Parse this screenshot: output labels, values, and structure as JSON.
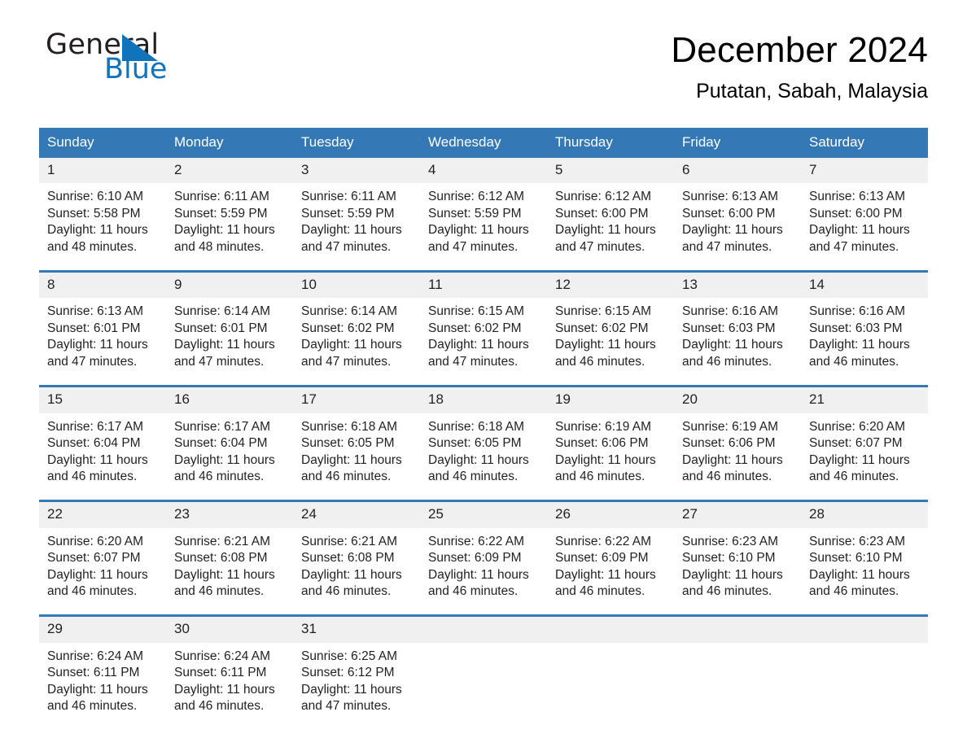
{
  "brand": {
    "name_part1": "General",
    "name_part2": "Blue",
    "logo_icon": "triangle-logo-icon",
    "accent_color": "#1173ba"
  },
  "header": {
    "title": "December 2024",
    "subtitle": "Putatan, Sabah, Malaysia"
  },
  "calendar": {
    "header_bg": "#3478b6",
    "daynum_bg": "#f0f0f0",
    "weekday_headers": [
      "Sunday",
      "Monday",
      "Tuesday",
      "Wednesday",
      "Thursday",
      "Friday",
      "Saturday"
    ],
    "weeks": [
      {
        "days": [
          {
            "num": "1",
            "sunrise": "Sunrise: 6:10 AM",
            "sunset": "Sunset: 5:58 PM",
            "daylight_line1": "Daylight: 11 hours",
            "daylight_line2": "and 48 minutes."
          },
          {
            "num": "2",
            "sunrise": "Sunrise: 6:11 AM",
            "sunset": "Sunset: 5:59 PM",
            "daylight_line1": "Daylight: 11 hours",
            "daylight_line2": "and 48 minutes."
          },
          {
            "num": "3",
            "sunrise": "Sunrise: 6:11 AM",
            "sunset": "Sunset: 5:59 PM",
            "daylight_line1": "Daylight: 11 hours",
            "daylight_line2": "and 47 minutes."
          },
          {
            "num": "4",
            "sunrise": "Sunrise: 6:12 AM",
            "sunset": "Sunset: 5:59 PM",
            "daylight_line1": "Daylight: 11 hours",
            "daylight_line2": "and 47 minutes."
          },
          {
            "num": "5",
            "sunrise": "Sunrise: 6:12 AM",
            "sunset": "Sunset: 6:00 PM",
            "daylight_line1": "Daylight: 11 hours",
            "daylight_line2": "and 47 minutes."
          },
          {
            "num": "6",
            "sunrise": "Sunrise: 6:13 AM",
            "sunset": "Sunset: 6:00 PM",
            "daylight_line1": "Daylight: 11 hours",
            "daylight_line2": "and 47 minutes."
          },
          {
            "num": "7",
            "sunrise": "Sunrise: 6:13 AM",
            "sunset": "Sunset: 6:00 PM",
            "daylight_line1": "Daylight: 11 hours",
            "daylight_line2": "and 47 minutes."
          }
        ]
      },
      {
        "days": [
          {
            "num": "8",
            "sunrise": "Sunrise: 6:13 AM",
            "sunset": "Sunset: 6:01 PM",
            "daylight_line1": "Daylight: 11 hours",
            "daylight_line2": "and 47 minutes."
          },
          {
            "num": "9",
            "sunrise": "Sunrise: 6:14 AM",
            "sunset": "Sunset: 6:01 PM",
            "daylight_line1": "Daylight: 11 hours",
            "daylight_line2": "and 47 minutes."
          },
          {
            "num": "10",
            "sunrise": "Sunrise: 6:14 AM",
            "sunset": "Sunset: 6:02 PM",
            "daylight_line1": "Daylight: 11 hours",
            "daylight_line2": "and 47 minutes."
          },
          {
            "num": "11",
            "sunrise": "Sunrise: 6:15 AM",
            "sunset": "Sunset: 6:02 PM",
            "daylight_line1": "Daylight: 11 hours",
            "daylight_line2": "and 47 minutes."
          },
          {
            "num": "12",
            "sunrise": "Sunrise: 6:15 AM",
            "sunset": "Sunset: 6:02 PM",
            "daylight_line1": "Daylight: 11 hours",
            "daylight_line2": "and 46 minutes."
          },
          {
            "num": "13",
            "sunrise": "Sunrise: 6:16 AM",
            "sunset": "Sunset: 6:03 PM",
            "daylight_line1": "Daylight: 11 hours",
            "daylight_line2": "and 46 minutes."
          },
          {
            "num": "14",
            "sunrise": "Sunrise: 6:16 AM",
            "sunset": "Sunset: 6:03 PM",
            "daylight_line1": "Daylight: 11 hours",
            "daylight_line2": "and 46 minutes."
          }
        ]
      },
      {
        "days": [
          {
            "num": "15",
            "sunrise": "Sunrise: 6:17 AM",
            "sunset": "Sunset: 6:04 PM",
            "daylight_line1": "Daylight: 11 hours",
            "daylight_line2": "and 46 minutes."
          },
          {
            "num": "16",
            "sunrise": "Sunrise: 6:17 AM",
            "sunset": "Sunset: 6:04 PM",
            "daylight_line1": "Daylight: 11 hours",
            "daylight_line2": "and 46 minutes."
          },
          {
            "num": "17",
            "sunrise": "Sunrise: 6:18 AM",
            "sunset": "Sunset: 6:05 PM",
            "daylight_line1": "Daylight: 11 hours",
            "daylight_line2": "and 46 minutes."
          },
          {
            "num": "18",
            "sunrise": "Sunrise: 6:18 AM",
            "sunset": "Sunset: 6:05 PM",
            "daylight_line1": "Daylight: 11 hours",
            "daylight_line2": "and 46 minutes."
          },
          {
            "num": "19",
            "sunrise": "Sunrise: 6:19 AM",
            "sunset": "Sunset: 6:06 PM",
            "daylight_line1": "Daylight: 11 hours",
            "daylight_line2": "and 46 minutes."
          },
          {
            "num": "20",
            "sunrise": "Sunrise: 6:19 AM",
            "sunset": "Sunset: 6:06 PM",
            "daylight_line1": "Daylight: 11 hours",
            "daylight_line2": "and 46 minutes."
          },
          {
            "num": "21",
            "sunrise": "Sunrise: 6:20 AM",
            "sunset": "Sunset: 6:07 PM",
            "daylight_line1": "Daylight: 11 hours",
            "daylight_line2": "and 46 minutes."
          }
        ]
      },
      {
        "days": [
          {
            "num": "22",
            "sunrise": "Sunrise: 6:20 AM",
            "sunset": "Sunset: 6:07 PM",
            "daylight_line1": "Daylight: 11 hours",
            "daylight_line2": "and 46 minutes."
          },
          {
            "num": "23",
            "sunrise": "Sunrise: 6:21 AM",
            "sunset": "Sunset: 6:08 PM",
            "daylight_line1": "Daylight: 11 hours",
            "daylight_line2": "and 46 minutes."
          },
          {
            "num": "24",
            "sunrise": "Sunrise: 6:21 AM",
            "sunset": "Sunset: 6:08 PM",
            "daylight_line1": "Daylight: 11 hours",
            "daylight_line2": "and 46 minutes."
          },
          {
            "num": "25",
            "sunrise": "Sunrise: 6:22 AM",
            "sunset": "Sunset: 6:09 PM",
            "daylight_line1": "Daylight: 11 hours",
            "daylight_line2": "and 46 minutes."
          },
          {
            "num": "26",
            "sunrise": "Sunrise: 6:22 AM",
            "sunset": "Sunset: 6:09 PM",
            "daylight_line1": "Daylight: 11 hours",
            "daylight_line2": "and 46 minutes."
          },
          {
            "num": "27",
            "sunrise": "Sunrise: 6:23 AM",
            "sunset": "Sunset: 6:10 PM",
            "daylight_line1": "Daylight: 11 hours",
            "daylight_line2": "and 46 minutes."
          },
          {
            "num": "28",
            "sunrise": "Sunrise: 6:23 AM",
            "sunset": "Sunset: 6:10 PM",
            "daylight_line1": "Daylight: 11 hours",
            "daylight_line2": "and 46 minutes."
          }
        ]
      },
      {
        "days": [
          {
            "num": "29",
            "sunrise": "Sunrise: 6:24 AM",
            "sunset": "Sunset: 6:11 PM",
            "daylight_line1": "Daylight: 11 hours",
            "daylight_line2": "and 46 minutes."
          },
          {
            "num": "30",
            "sunrise": "Sunrise: 6:24 AM",
            "sunset": "Sunset: 6:11 PM",
            "daylight_line1": "Daylight: 11 hours",
            "daylight_line2": "and 46 minutes."
          },
          {
            "num": "31",
            "sunrise": "Sunrise: 6:25 AM",
            "sunset": "Sunset: 6:12 PM",
            "daylight_line1": "Daylight: 11 hours",
            "daylight_line2": "and 47 minutes."
          },
          {
            "num": "",
            "sunrise": "",
            "sunset": "",
            "daylight_line1": "",
            "daylight_line2": ""
          },
          {
            "num": "",
            "sunrise": "",
            "sunset": "",
            "daylight_line1": "",
            "daylight_line2": ""
          },
          {
            "num": "",
            "sunrise": "",
            "sunset": "",
            "daylight_line1": "",
            "daylight_line2": ""
          },
          {
            "num": "",
            "sunrise": "",
            "sunset": "",
            "daylight_line1": "",
            "daylight_line2": ""
          }
        ]
      }
    ]
  }
}
